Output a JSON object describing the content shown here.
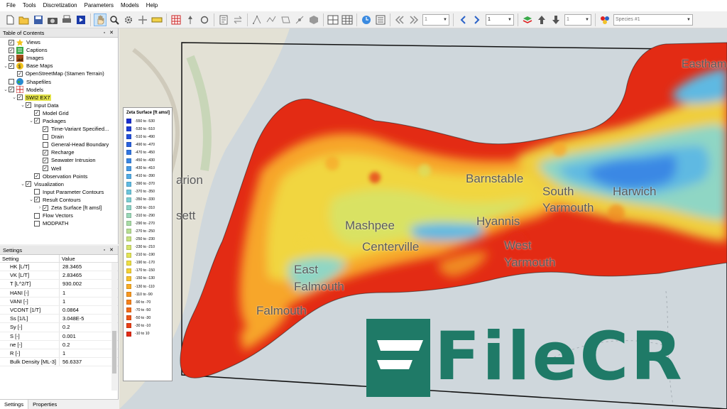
{
  "menu": [
    "File",
    "Tools",
    "Discretization",
    "Parameters",
    "Models",
    "Help"
  ],
  "toolbar": {
    "layer_combo": "1",
    "page_combo": "1",
    "stress_combo": "1",
    "species_combo": "Species #1"
  },
  "toc": {
    "title": "Table of Contents",
    "items": [
      {
        "label": "Views",
        "checked": true,
        "level": 0,
        "icon": "star-icon",
        "exp": ""
      },
      {
        "label": "Captions",
        "checked": true,
        "level": 0,
        "icon": "caption-icon",
        "exp": ""
      },
      {
        "label": "Images",
        "checked": true,
        "level": 0,
        "icon": "image-icon",
        "exp": ""
      },
      {
        "label": "Base Maps",
        "checked": true,
        "level": 0,
        "icon": "basemap-icon",
        "exp": "v"
      },
      {
        "label": "OpenStreetMap (Stamen Terrain)",
        "checked": true,
        "level": 1,
        "icon": "",
        "exp": ""
      },
      {
        "label": "Shapefiles",
        "checked": false,
        "level": 0,
        "icon": "globe-icon",
        "exp": ""
      },
      {
        "label": "Models",
        "checked": true,
        "level": 0,
        "icon": "models-icon",
        "exp": "v"
      },
      {
        "label": "SWI2 EX7",
        "checked": true,
        "level": 1,
        "icon": "",
        "exp": "v",
        "selected": true
      },
      {
        "label": "Input Data",
        "checked": true,
        "level": 2,
        "icon": "",
        "exp": "v"
      },
      {
        "label": "Model Grid",
        "checked": true,
        "level": 3,
        "icon": "",
        "exp": ""
      },
      {
        "label": "Packages",
        "checked": true,
        "level": 3,
        "icon": "",
        "exp": "v"
      },
      {
        "label": "Time-Variant Specified...",
        "checked": true,
        "level": 4,
        "icon": "",
        "exp": ""
      },
      {
        "label": "Drain",
        "checked": false,
        "level": 4,
        "icon": "",
        "exp": ""
      },
      {
        "label": "General-Head Boundary",
        "checked": false,
        "level": 4,
        "icon": "",
        "exp": ""
      },
      {
        "label": "Recharge",
        "checked": true,
        "level": 4,
        "icon": "",
        "exp": ""
      },
      {
        "label": "Seawater Intrusion",
        "checked": true,
        "level": 4,
        "icon": "",
        "exp": ""
      },
      {
        "label": "Well",
        "checked": true,
        "level": 4,
        "icon": "",
        "exp": ""
      },
      {
        "label": "Observation Points",
        "checked": true,
        "level": 3,
        "icon": "",
        "exp": ""
      },
      {
        "label": "Visualization",
        "checked": true,
        "level": 2,
        "icon": "",
        "exp": "v"
      },
      {
        "label": "Input Parameter Contours",
        "checked": false,
        "level": 3,
        "icon": "",
        "exp": ""
      },
      {
        "label": "Result Contours",
        "checked": true,
        "level": 3,
        "icon": "",
        "exp": "v"
      },
      {
        "label": "Zeta Surface [ft amsl]",
        "checked": true,
        "level": 4,
        "icon": "",
        "exp": ">"
      },
      {
        "label": "Flow Vectors",
        "checked": false,
        "level": 3,
        "icon": "",
        "exp": ""
      },
      {
        "label": "MODPATH",
        "checked": false,
        "level": 3,
        "icon": "",
        "exp": ""
      }
    ]
  },
  "settings": {
    "title": "Settings",
    "col_setting": "Setting",
    "col_value": "Value",
    "rows": [
      {
        "name": "HK [L/T]",
        "value": "28.3465"
      },
      {
        "name": "VK [L/T]",
        "value": "2.83465"
      },
      {
        "name": "T [L^2/T]",
        "value": "930.002"
      },
      {
        "name": "HANI [-]",
        "value": "1"
      },
      {
        "name": "VANI [-]",
        "value": "1"
      },
      {
        "name": "VCONT [1/T]",
        "value": "0.0864"
      },
      {
        "name": "Ss [1/L]",
        "value": "3.048E-5"
      },
      {
        "name": "Sy [-]",
        "value": "0.2"
      },
      {
        "name": "S [-]",
        "value": "0.001"
      },
      {
        "name": "ne [-]",
        "value": "0.2"
      },
      {
        "name": "R [-]",
        "value": "1"
      },
      {
        "name": "Bulk Density [ML-3]",
        "value": "56.6337"
      }
    ],
    "tabs": [
      "Settings",
      "Properties"
    ]
  },
  "legend": {
    "title": "Zeta Surface [ft amsl]",
    "entries": [
      {
        "label": "-550 to -530",
        "color": "#1a2fd1"
      },
      {
        "label": "-530 to -510",
        "color": "#1e3fd6"
      },
      {
        "label": "-510 to -490",
        "color": "#2350db"
      },
      {
        "label": "-490 to -470",
        "color": "#2a62df"
      },
      {
        "label": "-470 to -450",
        "color": "#3276e2"
      },
      {
        "label": "-450 to -430",
        "color": "#3b88e4"
      },
      {
        "label": "-430 to -410",
        "color": "#469be6"
      },
      {
        "label": "-410 to -390",
        "color": "#52ace6"
      },
      {
        "label": "-390 to -370",
        "color": "#5fbbe3"
      },
      {
        "label": "-370 to -350",
        "color": "#6dc6dc"
      },
      {
        "label": "-350 to -330",
        "color": "#7ccfd3"
      },
      {
        "label": "-330 to -310",
        "color": "#8bd4c6"
      },
      {
        "label": "-310 to -290",
        "color": "#9ad8b7"
      },
      {
        "label": "-290 to -270",
        "color": "#a9dca6"
      },
      {
        "label": "-270 to -250",
        "color": "#b8df93"
      },
      {
        "label": "-250 to -230",
        "color": "#c7e27e"
      },
      {
        "label": "-230 to -210",
        "color": "#d6e46a"
      },
      {
        "label": "-210 to -190",
        "color": "#e3e455"
      },
      {
        "label": "-190 to -170",
        "color": "#eedf42"
      },
      {
        "label": "-170 to -150",
        "color": "#f5d233"
      },
      {
        "label": "-150 to -130",
        "color": "#f8c12a"
      },
      {
        "label": "-130 to -110",
        "color": "#f9ad24"
      },
      {
        "label": "-110 to -90",
        "color": "#f8981f"
      },
      {
        "label": "-90 to -70",
        "color": "#f6821b"
      },
      {
        "label": "-70 to -50",
        "color": "#f26b18"
      },
      {
        "label": "-50 to -30",
        "color": "#ee5516"
      },
      {
        "label": "-30 to -10",
        "color": "#e93f15"
      },
      {
        "label": "-10 to 10",
        "color": "#e32b14"
      }
    ]
  },
  "map": {
    "towns": [
      "Eastham",
      "Barnstable",
      "South",
      "Yarmouth",
      "Harwich",
      "Hyannis",
      "Mashpee",
      "Centerville",
      "West",
      "Yarmouth",
      "East",
      "Falmouth",
      "Falmouth",
      "arion",
      "sett"
    ]
  },
  "watermark": "FileCR"
}
